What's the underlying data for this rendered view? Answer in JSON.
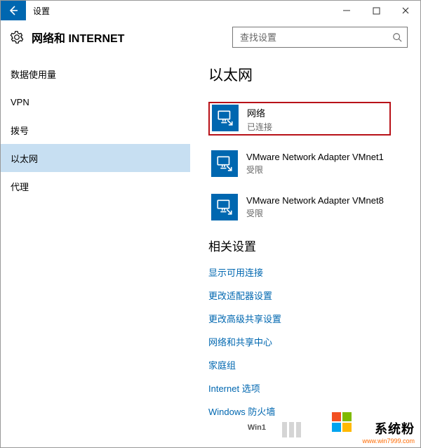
{
  "titlebar": {
    "title": "设置"
  },
  "header": {
    "title": "网络和 INTERNET",
    "search_placeholder": "查找设置"
  },
  "sidebar": {
    "items": [
      {
        "label": "数据使用量",
        "selected": false
      },
      {
        "label": "VPN",
        "selected": false
      },
      {
        "label": "拨号",
        "selected": false
      },
      {
        "label": "以太网",
        "selected": true
      },
      {
        "label": "代理",
        "selected": false
      }
    ]
  },
  "main": {
    "page_title": "以太网",
    "networks": [
      {
        "name": "网络",
        "status": "已连接",
        "highlight": true
      },
      {
        "name": "VMware Network Adapter VMnet1",
        "status": "受限",
        "highlight": false
      },
      {
        "name": "VMware Network Adapter VMnet8",
        "status": "受限",
        "highlight": false
      }
    ],
    "related_title": "相关设置",
    "related_links": [
      "显示可用连接",
      "更改适配器设置",
      "更改高级共享设置",
      "网络和共享中心",
      "家庭组",
      "Internet 选项",
      "Windows 防火墙"
    ]
  },
  "watermark": {
    "brand": "系统粉",
    "url": "www.win7999.com",
    "small": "Win1"
  }
}
